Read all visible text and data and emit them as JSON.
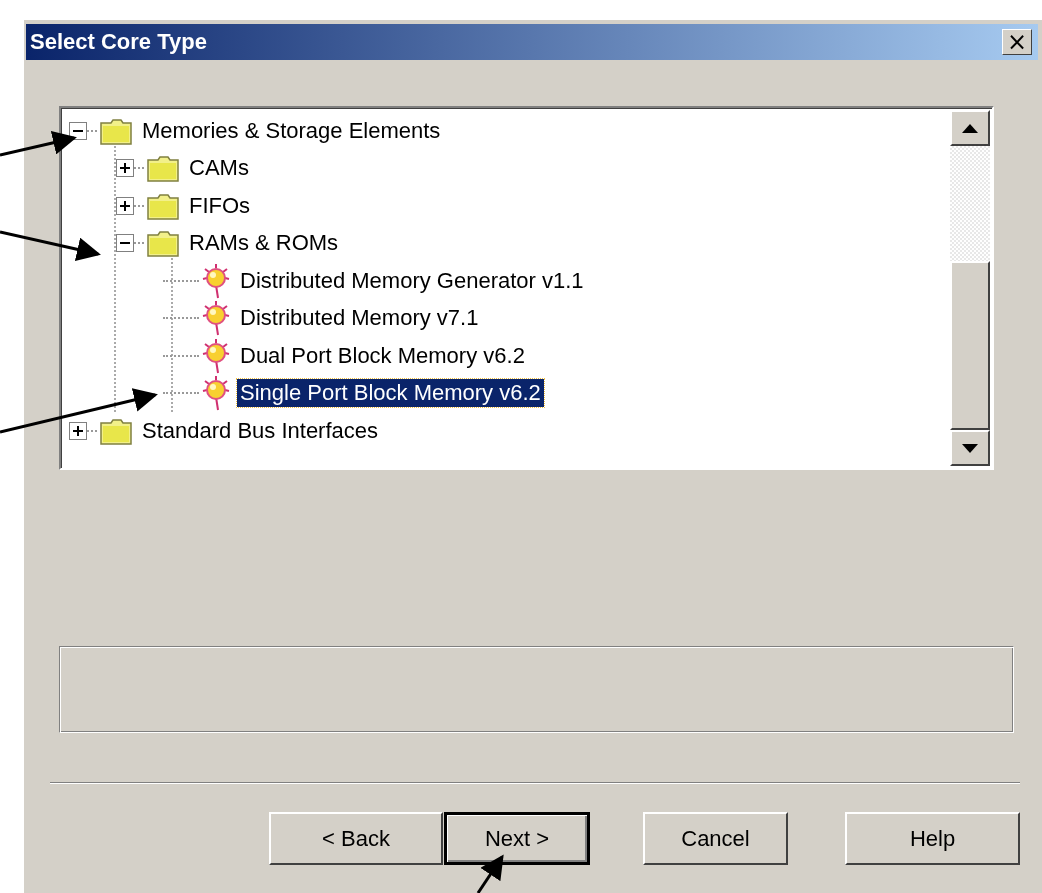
{
  "window": {
    "title": "Select Core Type",
    "close_label": "×"
  },
  "tree": {
    "items": [
      {
        "label": "Memories & Storage Elements",
        "kind": "folder",
        "expanded": true,
        "selected": false,
        "children": [
          {
            "label": "CAMs",
            "kind": "folder",
            "expanded": false,
            "selected": false
          },
          {
            "label": "FIFOs",
            "kind": "folder",
            "expanded": false,
            "selected": false
          },
          {
            "label": "RAMs & ROMs",
            "kind": "folder",
            "expanded": true,
            "selected": false,
            "children": [
              {
                "label": "Distributed Memory Generator v1.1",
                "kind": "core",
                "selected": false
              },
              {
                "label": "Distributed Memory v7.1",
                "kind": "core",
                "selected": false
              },
              {
                "label": "Dual Port Block Memory v6.2",
                "kind": "core",
                "selected": false
              },
              {
                "label": "Single Port Block Memory v6.2",
                "kind": "core",
                "selected": true
              }
            ]
          }
        ]
      },
      {
        "label": "Standard Bus Interfaces",
        "kind": "folder",
        "expanded": false,
        "selected": false
      }
    ]
  },
  "buttons": [
    {
      "label": "< Back",
      "default": false
    },
    {
      "label": "Next >",
      "default": true
    },
    {
      "label": "Cancel",
      "default": false
    },
    {
      "label": "Help",
      "default": false
    }
  ]
}
